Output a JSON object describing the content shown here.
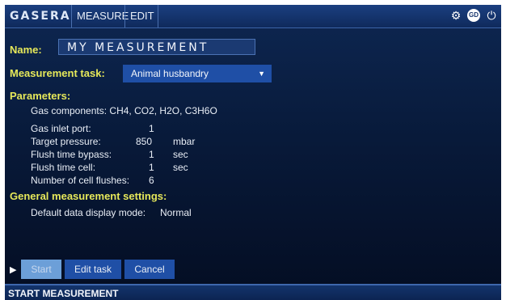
{
  "header": {
    "logo": "GASERA",
    "tabs": [
      {
        "label": "MEASURE"
      },
      {
        "label": "EDIT"
      }
    ],
    "icons": [
      "gear-icon",
      "gd-icon",
      "power-icon"
    ]
  },
  "form": {
    "name_label": "Name:",
    "name_value": "MY MEASUREMENT",
    "task_label": "Measurement task:",
    "task_value": "Animal husbandry",
    "parameters_label": "Parameters:",
    "gas_components_label": "Gas components:",
    "gas_components_value": "CH4, CO2, H2O, C3H6O",
    "params": [
      {
        "key": "Gas inlet port:",
        "value": "1",
        "unit": ""
      },
      {
        "key": "Target pressure:",
        "value": "850",
        "unit": "mbar"
      },
      {
        "key": "Flush time bypass:",
        "value": "1",
        "unit": "sec"
      },
      {
        "key": "Flush time cell:",
        "value": "1",
        "unit": "sec"
      },
      {
        "key": "Number of cell flushes:",
        "value": "6",
        "unit": ""
      }
    ],
    "general_label": "General measurement settings:",
    "display_mode_label": "Default data display mode:",
    "display_mode_value": "Normal"
  },
  "buttons": {
    "start": "Start",
    "edit_task": "Edit task",
    "cancel": "Cancel"
  },
  "status": "START MEASUREMENT",
  "colors": {
    "accent": "#1f4fa6",
    "label_yellow": "#e6e85a",
    "background": "#081a3a"
  }
}
